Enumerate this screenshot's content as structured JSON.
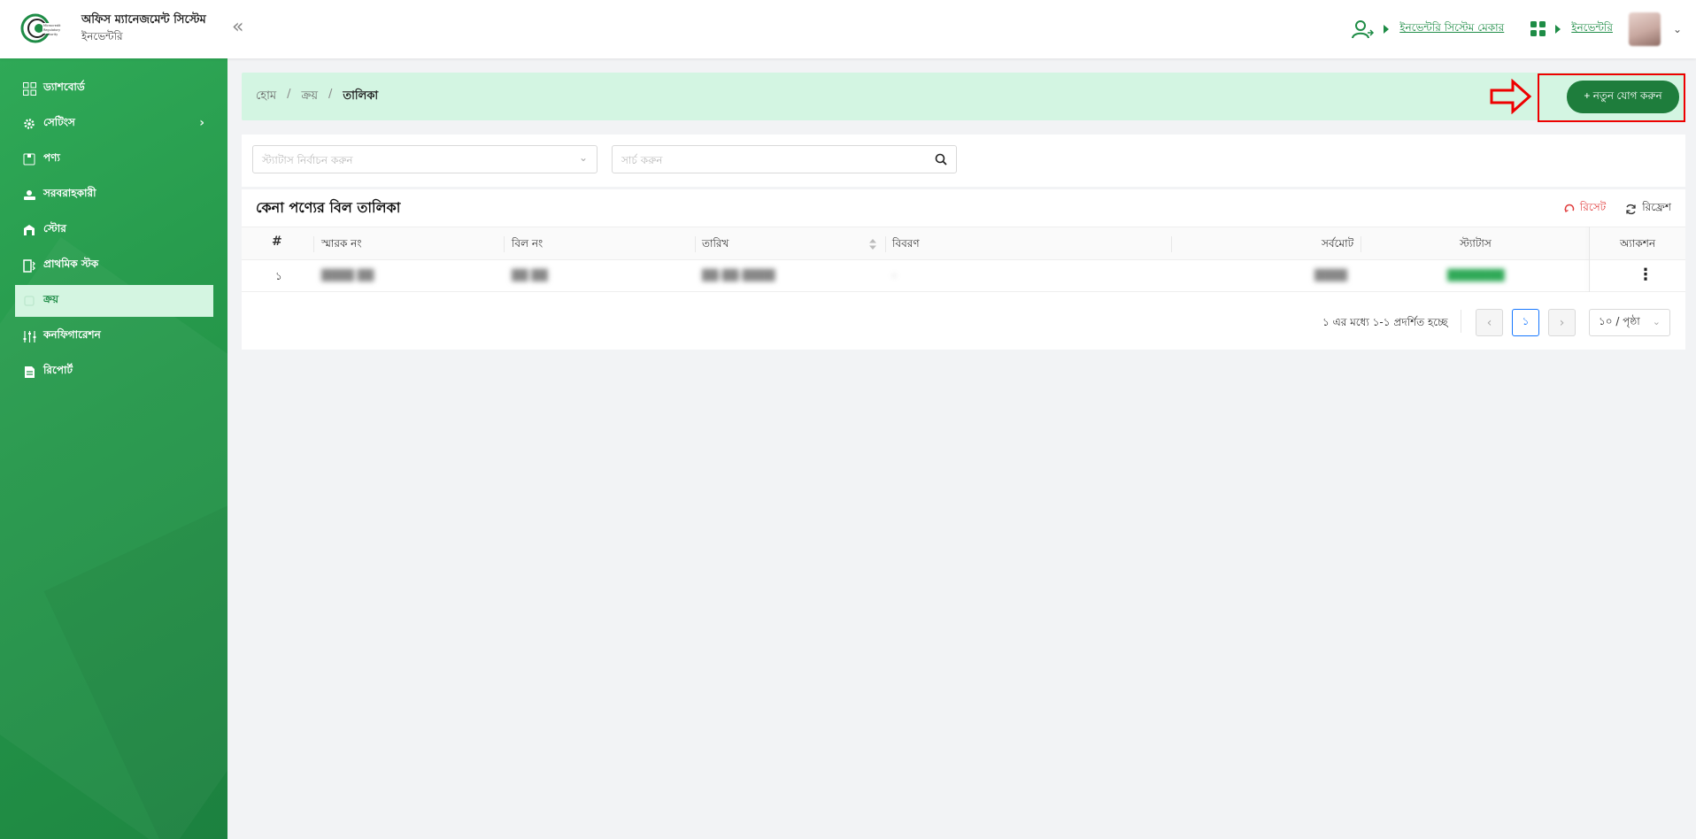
{
  "header": {
    "app_title": "অফিস ম্যানেজমেন্ট সিস্টেম",
    "app_subtitle": "ইনভেন্টরি",
    "collapse_icon": "«",
    "user_role_link": "ইনভেন্টরি সিস্টেম মেকার",
    "module_link": "ইনভেন্টরি",
    "accent_color": "#1e8c46"
  },
  "sidebar": {
    "items": [
      {
        "label": "ড্যাশবোর্ড",
        "icon": "dashboard-icon"
      },
      {
        "label": "সেটিংস",
        "icon": "gear-icon"
      },
      {
        "label": "পণ্য",
        "icon": "product-icon"
      },
      {
        "label": "সরবরাহকারী",
        "icon": "supplier-icon"
      },
      {
        "label": "স্টোর",
        "icon": "store-icon"
      },
      {
        "label": "প্রাথমিক স্টক",
        "icon": "stock-icon"
      },
      {
        "label": "ক্রয়",
        "icon": "purchase-icon"
      },
      {
        "label": "কনফিগারেশন",
        "icon": "sliders-icon"
      },
      {
        "label": "রিপোর্ট",
        "icon": "report-icon"
      }
    ],
    "active_index": 6,
    "background": "#25974a"
  },
  "breadcrumb": {
    "home": "হোম",
    "parent": "ক্রয়",
    "current": "তালিকা"
  },
  "add_button": "+ নতুন যোগ করুন",
  "filters": {
    "status_placeholder": "স্ট্যাটাস নির্বাচন করুন",
    "search_placeholder": "সার্চ করুন"
  },
  "table": {
    "title": "কেনা পণ্যের বিল তালিকা",
    "reset_label": "রিসেট",
    "refresh_label": "রিফ্রেশ",
    "columns": {
      "index": "#",
      "memo": "স্মারক নং",
      "bill": "বিল নং",
      "date": "তারিখ",
      "details": "বিবরণ",
      "total": "সর্বমোট",
      "status": "স্ট্যাটাস",
      "action": "অ্যাকশন"
    },
    "rows": [
      {
        "index": "১",
        "memo": "████ ██",
        "bill": "██ ██",
        "date": "██-██-████",
        "details": "-",
        "total": "████",
        "status": "███████"
      }
    ]
  },
  "pagination": {
    "info": "১ এর মধ্যে ১-১ প্রদর্শিত হচ্ছে",
    "current_page": "১",
    "page_size": "১০ / পৃষ্ঠা"
  }
}
